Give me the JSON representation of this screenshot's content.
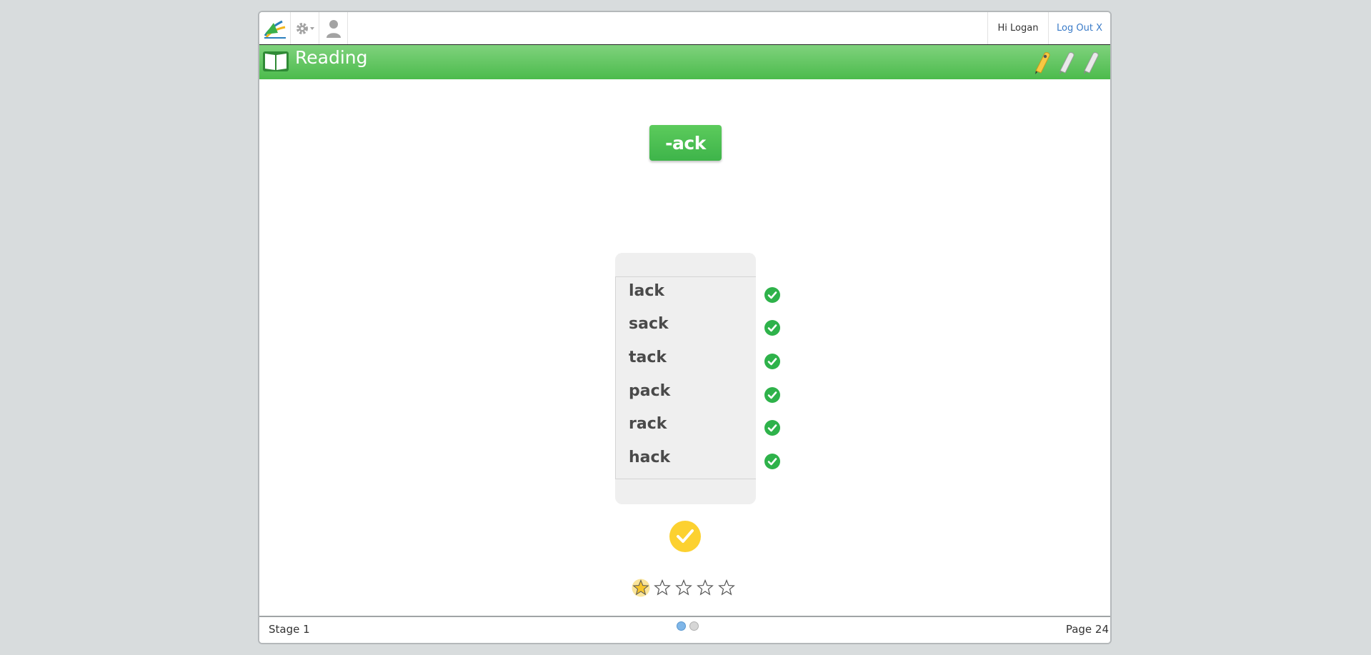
{
  "topnav": {
    "greeting": "Hi Logan",
    "logout_label": "Log Out X"
  },
  "header": {
    "title": "Reading",
    "pencils": [
      {
        "icon": "pencil-icon",
        "active": true
      },
      {
        "icon": "pencil-icon",
        "active": false
      },
      {
        "icon": "pencil-icon",
        "active": false
      }
    ]
  },
  "activity": {
    "phonogram": "-ack",
    "words": [
      {
        "text": "lack",
        "correct": true
      },
      {
        "text": "sack",
        "correct": true
      },
      {
        "text": "tack",
        "correct": true
      },
      {
        "text": "pack",
        "correct": true
      },
      {
        "text": "rack",
        "correct": true
      },
      {
        "text": "hack",
        "correct": true
      }
    ],
    "rating": {
      "filled": 1,
      "total": 5
    }
  },
  "footer": {
    "stage": "Stage 1",
    "page": "Page 24",
    "pager": {
      "current": 1,
      "total": 2
    }
  },
  "colors": {
    "green": "#4cbb4c",
    "check_green": "#2eb24a",
    "done_yellow": "#fcd130",
    "link_blue": "#3a7bc8",
    "active_dot": "#7fb6e8"
  }
}
